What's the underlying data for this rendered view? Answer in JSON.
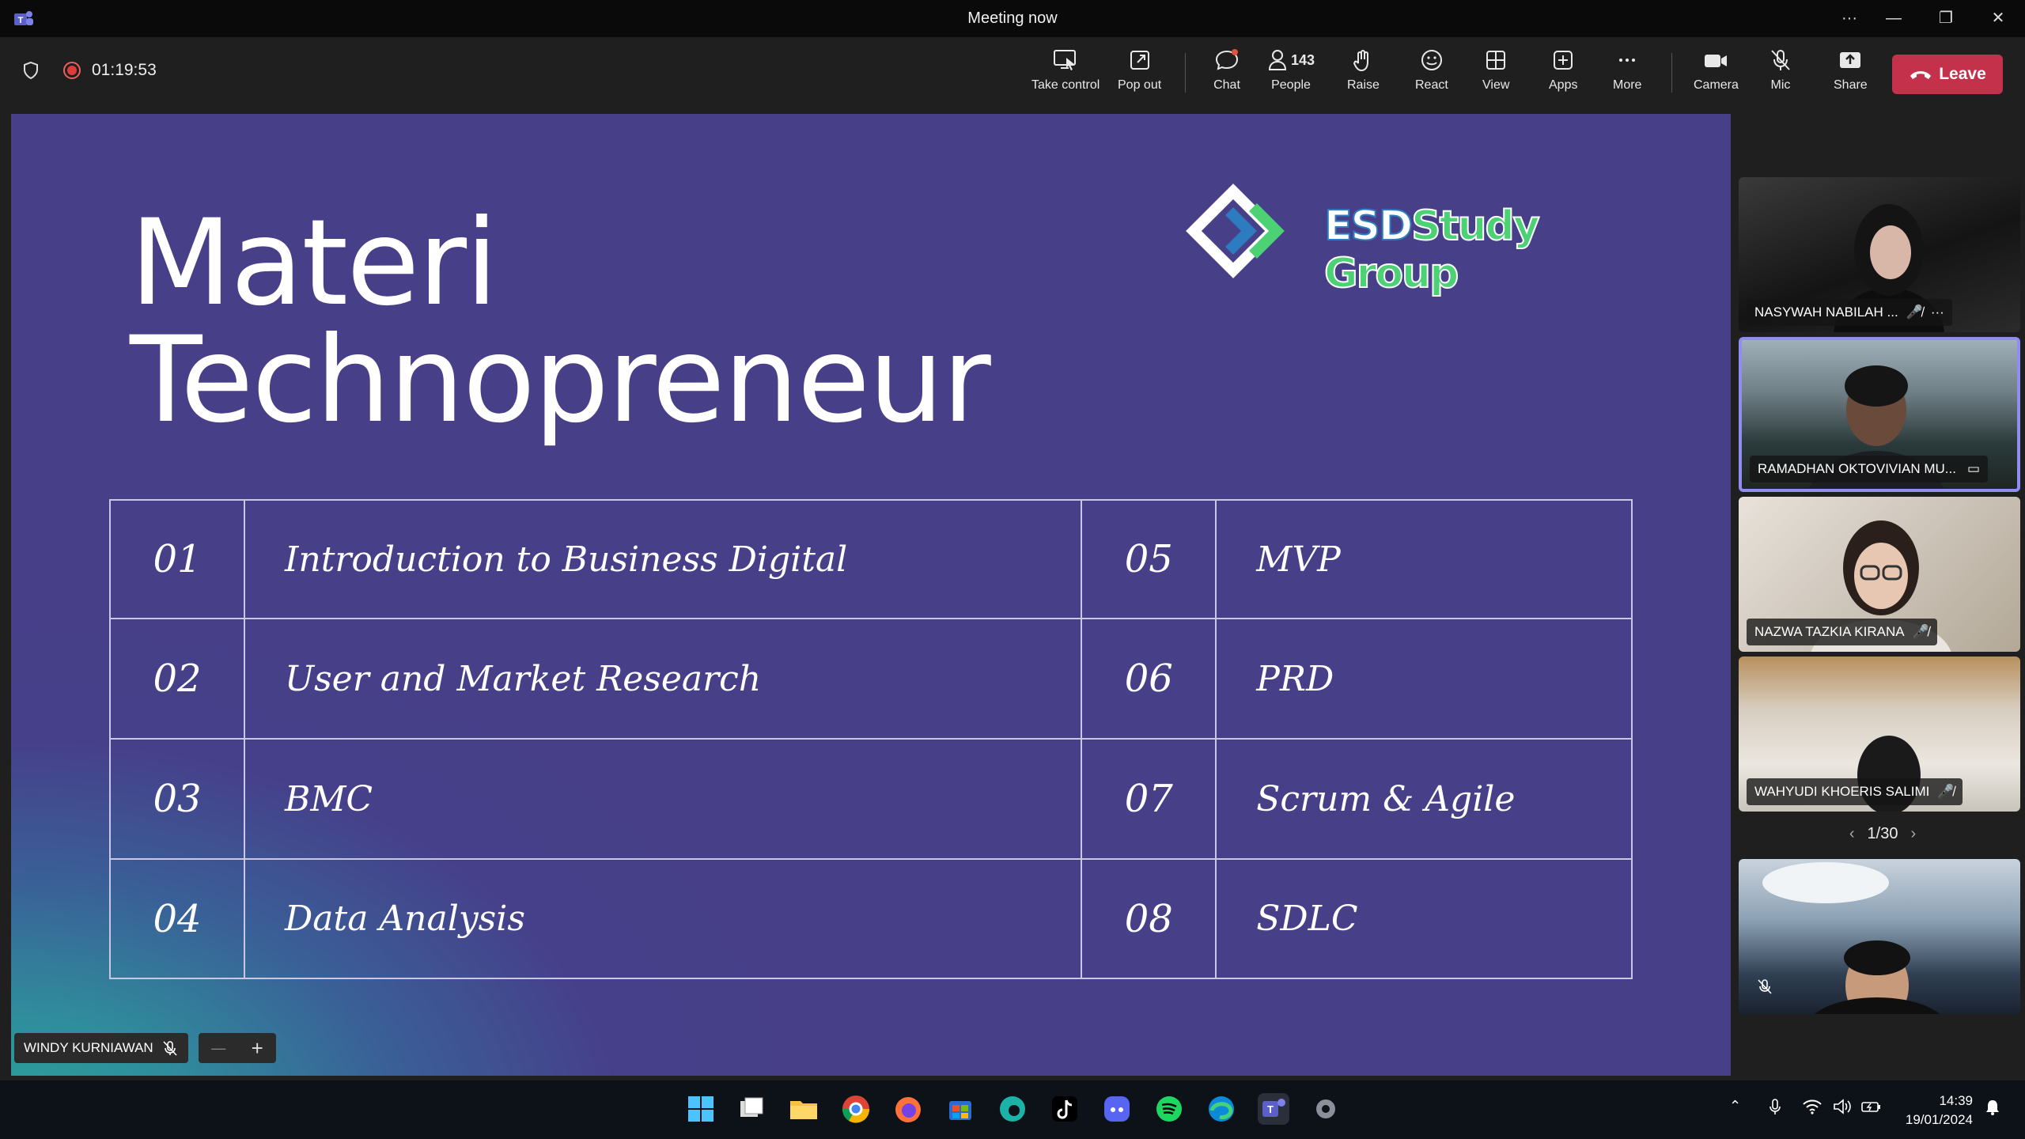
{
  "window": {
    "title": "Meeting now",
    "controls": [
      "···",
      "—",
      "❐",
      "✕"
    ]
  },
  "toolbar": {
    "timer": "01:19:53",
    "buttons": {
      "take_control": "Take control",
      "pop_out": "Pop out",
      "chat": "Chat",
      "people": "People",
      "people_count": "143",
      "raise": "Raise",
      "react": "React",
      "view": "View",
      "apps": "Apps",
      "more": "More",
      "camera": "Camera",
      "mic": "Mic",
      "share": "Share",
      "leave": "Leave"
    }
  },
  "slide": {
    "title_line1": "Materi",
    "title_line2": "Technopreneur",
    "logo_esd": "ESD",
    "logo_study_group": "Study Group",
    "topics": [
      {
        "num": "01",
        "label": "Introduction to Business Digital",
        "num2": "05",
        "label2": "MVP"
      },
      {
        "num": "02",
        "label": "User and Market Research",
        "num2": "06",
        "label2": "PRD"
      },
      {
        "num": "03",
        "label": "BMC",
        "num2": "07",
        "label2": "Scrum & Agile"
      },
      {
        "num": "04",
        "label": "Data Analysis",
        "num2": "08",
        "label2": "SDLC"
      }
    ]
  },
  "speaker": {
    "name": "WINDY KURNIAWAN",
    "zoom_minus": "—",
    "zoom_plus": "+"
  },
  "participants": [
    {
      "name": "NASYWAH NABILAH ..."
    },
    {
      "name": "RAMADHAN OKTOVIVIAN MU..."
    },
    {
      "name": "NAZWA TAZKIA KIRANA"
    },
    {
      "name": "WAHYUDI KHOERIS SALIMI"
    }
  ],
  "pager": {
    "label": "1/30"
  },
  "taskbar": {
    "time": "14:39",
    "date": "19/01/2024"
  },
  "colors": {
    "leave": "#c4314b",
    "slide_bg": "#473f88",
    "active_border": "#8f8df0"
  }
}
